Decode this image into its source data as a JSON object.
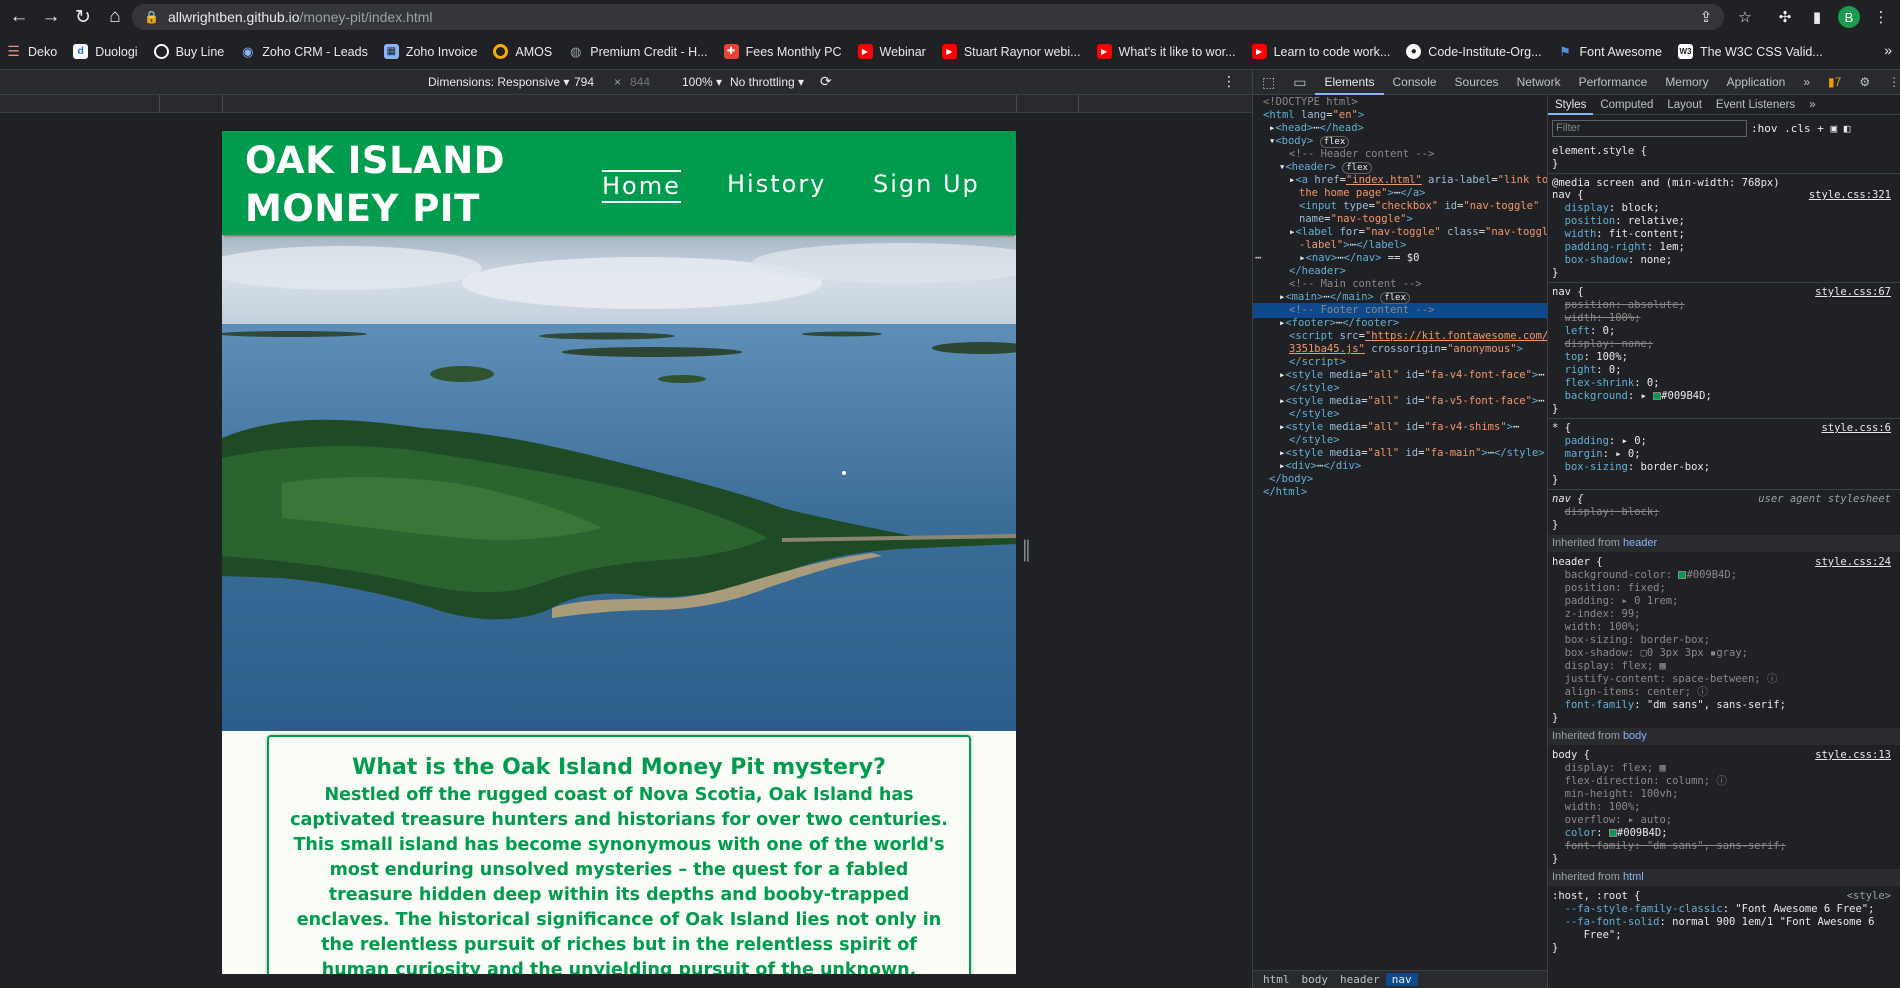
{
  "browser": {
    "url_host": "allwrightben.github.io",
    "url_path": "/money-pit/index.html",
    "profile_initial": "B",
    "bookmarks": [
      {
        "label": "Deko",
        "icon": "menu-icon",
        "color": "#f28b82"
      },
      {
        "label": "Duologi",
        "icon": "d-logo-icon",
        "color": "#1a73e8"
      },
      {
        "label": "Buy Line",
        "icon": "circle-logo-icon",
        "color": "#ffffff"
      },
      {
        "label": "Zoho CRM - Leads",
        "icon": "zoho-icon",
        "color": "#8ab4f8"
      },
      {
        "label": "Zoho Invoice",
        "icon": "invoice-icon",
        "color": "#8ab4f8"
      },
      {
        "label": "AMOS",
        "icon": "ring-icon",
        "color": "#f9ab00"
      },
      {
        "label": "Premium Credit - H...",
        "icon": "globe-icon",
        "color": "#9aa0a6"
      },
      {
        "label": "Fees Monthly PC",
        "icon": "cross-logo-icon",
        "color": "#ea4335"
      },
      {
        "label": "Webinar",
        "icon": "youtube-icon",
        "color": "#ff0000"
      },
      {
        "label": "Stuart Raynor webi...",
        "icon": "youtube-icon",
        "color": "#ff0000"
      },
      {
        "label": "What's it like to wor...",
        "icon": "youtube-icon",
        "color": "#ff0000"
      },
      {
        "label": "Learn to code work...",
        "icon": "youtube-icon",
        "color": "#ff0000"
      },
      {
        "label": "Code-Institute-Org...",
        "icon": "github-icon",
        "color": "#ffffff"
      },
      {
        "label": "Font Awesome",
        "icon": "flag-icon",
        "color": "#538dd7"
      },
      {
        "label": "The W3C CSS Valid...",
        "icon": "w3c-icon",
        "color": "#ffffff"
      }
    ],
    "bookmarks_more": "»"
  },
  "device_toolbar": {
    "dimensions_label": "Dimensions: Responsive",
    "width": "794",
    "times": "×",
    "height": "844",
    "zoom": "100%",
    "throttle": "No throttling"
  },
  "site": {
    "logo_line1": "OAK ISLAND",
    "logo_line2": "MONEY PIT",
    "nav": [
      "Home",
      "History",
      "Sign Up"
    ],
    "content_title": "What is the Oak Island Money Pit mystery?",
    "content_text": "Nestled off the rugged coast of Nova Scotia, Oak Island has captivated treasure hunters and historians for over two centuries. This small island has become synonymous with one of the world's most enduring unsolved mysteries – the quest for a fabled treasure hidden deep within its depths and booby-trapped enclaves. The historical significance of Oak Island lies not only in the relentless pursuit of riches but in the relentless spirit of human curiosity and the unyielding pursuit of the unknown, making it a compelling destination for those drawn to history's most enduring"
  },
  "devtools": {
    "tabs": [
      "Elements",
      "Console",
      "Sources",
      "Network",
      "Performance",
      "Memory",
      "Application",
      "»"
    ],
    "issues_count": "7",
    "style_tabs": [
      "Styles",
      "Computed",
      "Layout",
      "Event Listeners",
      "»"
    ],
    "filter_placeholder": "Filter",
    "hov_cls": ":hov  .cls",
    "breadcrumbs": [
      "html",
      "body",
      "header",
      "nav"
    ],
    "inherited_header": "header",
    "inherited_body": "body",
    "inherited_html": "html",
    "inherited_from": "Inherited from",
    "dom_badge_flex": "flex"
  }
}
